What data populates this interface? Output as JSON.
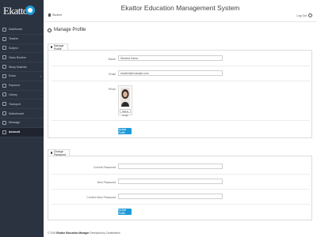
{
  "app": {
    "logo_text": "Ekattor",
    "system_title": "Ekattor Education Management System",
    "user_name": "Student",
    "logout_label": "Log Out"
  },
  "sidebar": {
    "items": [
      {
        "label": "Dashboard",
        "icon": "dashboard-icon"
      },
      {
        "label": "Teacher",
        "icon": "teacher-icon"
      },
      {
        "label": "Subject",
        "icon": "book-icon"
      },
      {
        "label": "Class Routine",
        "icon": "calendar-icon"
      },
      {
        "label": "Study Material",
        "icon": "folder-icon"
      },
      {
        "label": "Exam",
        "icon": "exam-icon",
        "has_children": true
      },
      {
        "label": "Payment",
        "icon": "payment-icon"
      },
      {
        "label": "Library",
        "icon": "library-icon"
      },
      {
        "label": "Transport",
        "icon": "bus-icon"
      },
      {
        "label": "Noticeboard",
        "icon": "notice-icon"
      },
      {
        "label": "Message",
        "icon": "message-icon"
      },
      {
        "label": "Account",
        "icon": "lock-icon",
        "active": true
      }
    ]
  },
  "page": {
    "title": "Manage Profile"
  },
  "profile_section": {
    "tab_label": "Manage Profile",
    "name_label": "Name",
    "name_value": "Student Demo",
    "email_label": "Email",
    "email_value": "student@example.com",
    "photo_label": "Photo",
    "photo_button": "Select image",
    "update_button": "Update Profile"
  },
  "password_section": {
    "tab_label": "Change Password",
    "current_label": "Current Password",
    "new_label": "New Password",
    "confirm_label": "Confirm New Password",
    "update_button": "Update Profile"
  },
  "footer": {
    "prefix": "© 2019",
    "brand": "Ekattor Education Manager",
    "suffix": "Developed by Creativeitem"
  },
  "colors": {
    "sidebar_bg": "#2c3340",
    "accent": "#1e9bd7"
  }
}
